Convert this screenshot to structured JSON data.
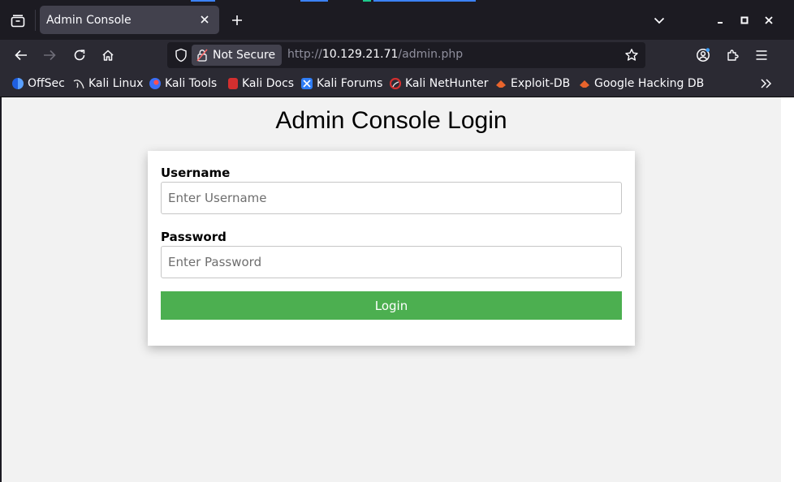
{
  "browser": {
    "tab": {
      "title": "Admin Console"
    },
    "url": {
      "security_label": "Not Secure",
      "scheme": "http://",
      "host": "10.129.21.71",
      "path": "/admin.php"
    },
    "bookmarks": [
      {
        "label": "OffSec",
        "icon": "offsec-icon",
        "color": "#3b82f6"
      },
      {
        "label": "Kali Linux",
        "icon": "kali-dragon-icon",
        "color": "#e5e5e5"
      },
      {
        "label": "Kali Tools",
        "icon": "kali-tools-icon",
        "color": "#3a6ff7"
      },
      {
        "label": "Kali Docs",
        "icon": "kali-docs-icon",
        "color": "#d32f2f"
      },
      {
        "label": "Kali Forums",
        "icon": "kali-forums-icon",
        "color": "#2f7df6"
      },
      {
        "label": "Kali NetHunter",
        "icon": "nethunter-icon",
        "color": "#d32f2f"
      },
      {
        "label": "Exploit-DB",
        "icon": "exploitdb-icon",
        "color": "#e8642c"
      },
      {
        "label": "Google Hacking DB",
        "icon": "ghdb-icon",
        "color": "#e8642c"
      }
    ]
  },
  "page": {
    "title": "Admin Console Login",
    "username": {
      "label": "Username",
      "placeholder": "Enter Username",
      "value": ""
    },
    "password": {
      "label": "Password",
      "placeholder": "Enter Password",
      "value": ""
    },
    "login_button": "Login"
  },
  "colors": {
    "accent_button": "#4caf50",
    "chrome_dark": "#1c1b22",
    "chrome": "#2b2a33",
    "page_bg": "#f2f2f2"
  }
}
